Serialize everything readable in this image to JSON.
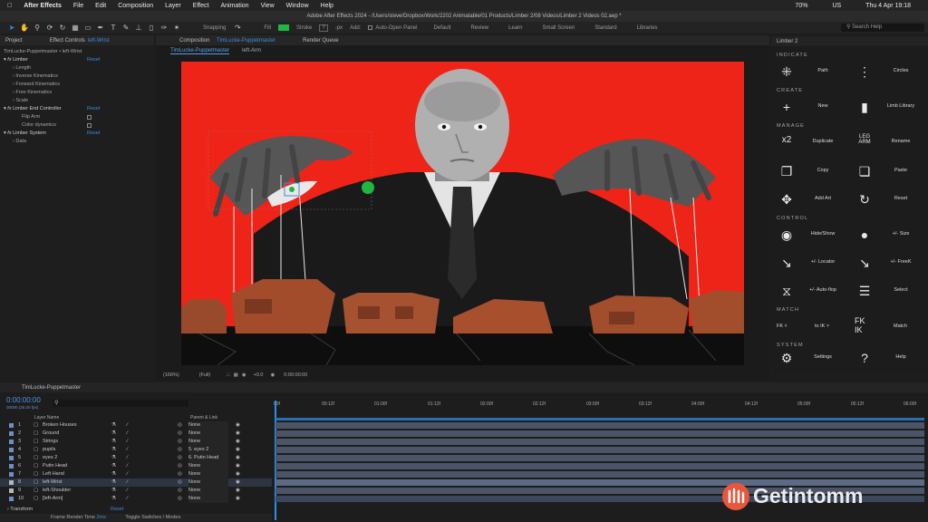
{
  "menubar": {
    "app": "After Effects",
    "items": [
      "File",
      "Edit",
      "Composition",
      "Layer",
      "Effect",
      "Animation",
      "View",
      "Window",
      "Help"
    ],
    "doc_title": "Adobe After Effects 2024 - /Users/steve/Dropbox/Work/2202 Animatable/01 Products/Limber 2/08 Videos/Limber 2 Videos 02.aep *",
    "battery": "70%",
    "input": "US",
    "clock": "Thu 4 Apr 19:18"
  },
  "toolbar": {
    "snapping": "Snapping",
    "fill": "Fill",
    "stroke": "Stroke",
    "stroke_value": "?",
    "px": "-px",
    "add": "Add:",
    "auto_open": "Auto-Open Panel",
    "workspaces": [
      "Default",
      "Review",
      "Learn",
      "Small Screen",
      "Standard",
      "Libraries"
    ],
    "search_placeholder": "Search Help",
    "fill_color": "#21b542"
  },
  "left_panel": {
    "tab_project": "Project",
    "tab_effect": "Effect Controls",
    "tab_effect_layer": "left-Wrist",
    "header": "TimLucke-Puppetmaster • left-Wrist",
    "limber": "Limber",
    "reset": "Reset",
    "props": [
      "Length",
      "Inverse Kinematics",
      "Forward Kinematics",
      "Free Kinematics",
      "Scale"
    ],
    "end_controller": "Limber End Controller",
    "flip_arm": "Flip Arm",
    "color_dynamics": "Color dynamics",
    "limber_system": "Limber System",
    "data": "Data"
  },
  "comp_panel": {
    "tab_label": "Composition",
    "tab_name": "TimLucke-Puppetmaster",
    "render_queue": "Render Queue",
    "subtabs": [
      "TimLucke-Puppetmaster",
      "left-Arm"
    ],
    "zoom": "(166%)",
    "resolution": "(Full)",
    "exposure": "+0.0",
    "timecode": "0:00:00:00"
  },
  "limber_panel": {
    "title": "Limber 2",
    "sections": {
      "indicate": "INDICATE",
      "create": "CREATE",
      "manage": "MANAGE",
      "control": "CONTROL",
      "match": "MATCH",
      "system": "SYSTEM"
    },
    "buttons": {
      "path": "Path",
      "circles": "Circles",
      "new": "New",
      "limb_library": "Limb Library",
      "duplicate": "Duplicate",
      "rename": "Rename",
      "copy": "Copy",
      "paste": "Paste",
      "add_art": "Add Art",
      "reset": "Reset",
      "hide_show": "Hide/Show",
      "size": "+/- Size",
      "locator": "+/- Locator",
      "freek": "+/- FreeK",
      "auto_flop": "+/- Auto-flop",
      "select": "Select",
      "fk": "FK",
      "to_ik": "to IK",
      "match": "Match",
      "settings": "Settings",
      "help": "Help"
    },
    "icon_text": {
      "x2": "x2",
      "leg_arm": "LEG ARM",
      "fk_ik": "FK IK"
    }
  },
  "timeline": {
    "tab": "TimLucke-Puppetmaster",
    "timecode": "0:00:00:00",
    "fps": "00000 (25.00 fps)",
    "col_layer_name": "Layer Name",
    "col_parent": "Parent & Link",
    "ruler": [
      "00f",
      "00:12f",
      "01:00f",
      "01:12f",
      "02:00f",
      "02:12f",
      "03:00f",
      "03:12f",
      "04:00f",
      "04:12f",
      "05:00f",
      "05:12f",
      "06:00f"
    ],
    "layers": [
      {
        "num": "1",
        "name": "Broken Houses",
        "parent": "None",
        "color": "#6f8fc2"
      },
      {
        "num": "2",
        "name": "Ground",
        "parent": "None",
        "color": "#6f8fc2"
      },
      {
        "num": "3",
        "name": "Strings",
        "parent": "None",
        "color": "#6f8fc2"
      },
      {
        "num": "4",
        "name": "pupils",
        "parent": "5. eyes 2",
        "color": "#6f8fc2"
      },
      {
        "num": "5",
        "name": "eyes 2",
        "parent": "6. Putin Head",
        "color": "#6f8fc2"
      },
      {
        "num": "6",
        "name": "Putin Head",
        "parent": "None",
        "color": "#6f8fc2"
      },
      {
        "num": "7",
        "name": "Left Hand",
        "parent": "None",
        "color": "#6f8fc2"
      },
      {
        "num": "8",
        "name": "left-Wrist",
        "parent": "None",
        "color": "#b7b7b7"
      },
      {
        "num": "9",
        "name": "left-Shoulder",
        "parent": "None",
        "color": "#b7b7b7"
      },
      {
        "num": "10",
        "name": "[left-Arm]",
        "parent": "None",
        "color": "#6f8fc2"
      }
    ],
    "transform": "Transform",
    "transform_reset": "Reset",
    "frame_render_time_label": "Frame Render Time",
    "frame_render_time": "2ms",
    "toggle_switches": "Toggle Switches / Modes"
  },
  "watermark": "Getintomm"
}
